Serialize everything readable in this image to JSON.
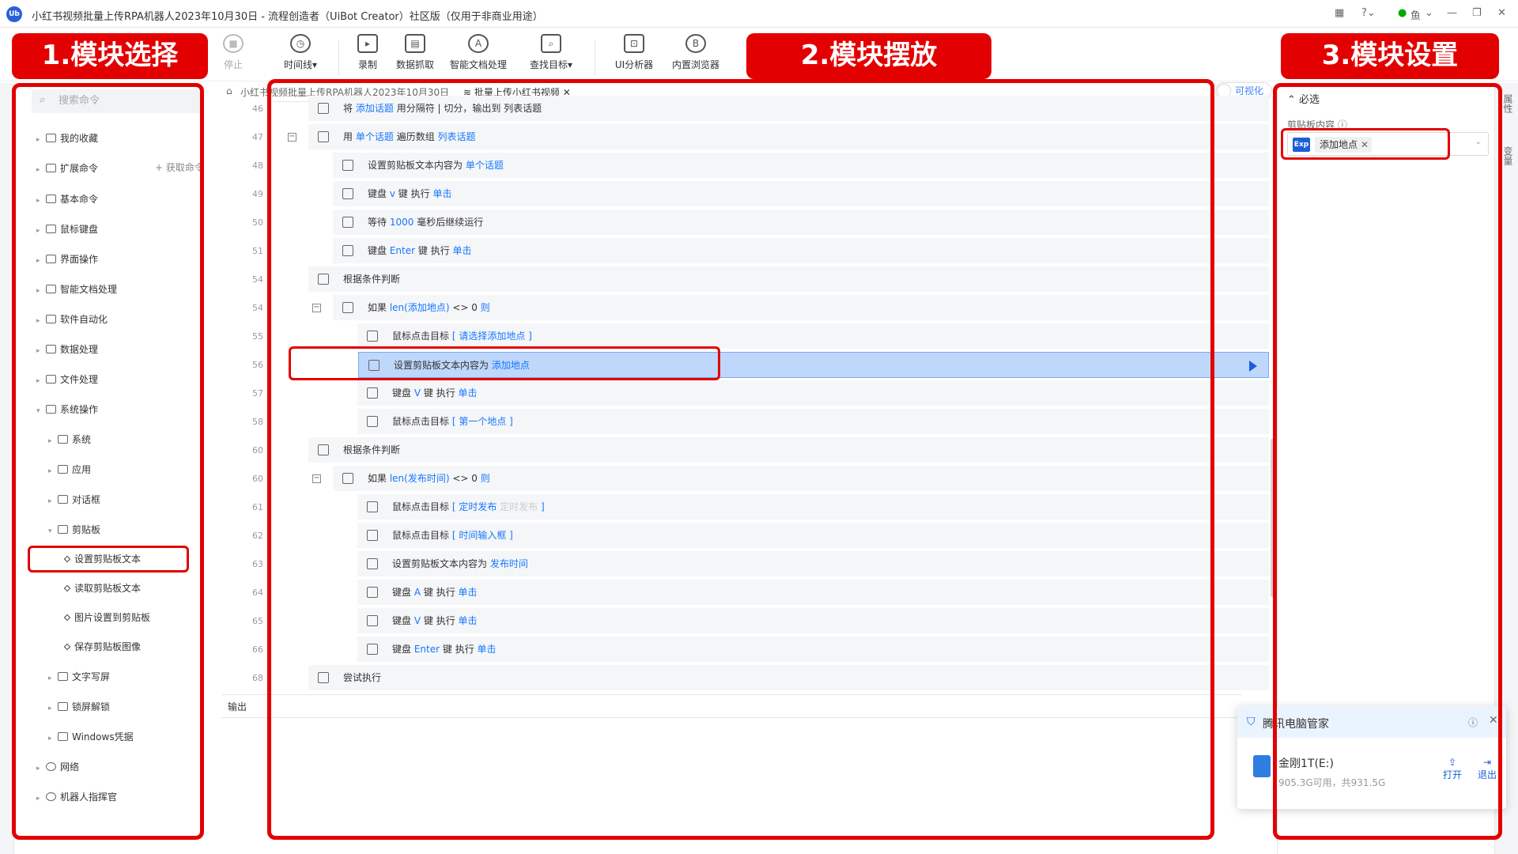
{
  "window": {
    "title": "小红书视频批量上传RPA机器人2023年10月30日 - 流程创造者（UiBot Creator）社区版（仅用于非商业用途）",
    "logo": "Ub",
    "user": "鱼"
  },
  "toolbar": {
    "stop": "停止",
    "timeline": "时间线▾",
    "record": "录制",
    "data_scrape": "数据抓取",
    "smart_doc": "智能文档处理",
    "find_target": "查找目标▾",
    "ui_analyzer": "UI分析器",
    "browser": "内置浏览器"
  },
  "annotations": {
    "section1": "1.模块选择",
    "section2": "2.模块摆放",
    "section3": "3.模块设置"
  },
  "left": {
    "search_placeholder": "搜索命令",
    "get_commands": "+ 获取命令",
    "items": [
      "我的收藏",
      "扩展命令",
      "基本命令",
      "鼠标键盘",
      "界面操作",
      "智能文档处理",
      "软件自动化",
      "数据处理",
      "文件处理",
      "系统操作"
    ],
    "sys_items": [
      "系统",
      "应用",
      "对话框",
      "剪贴板"
    ],
    "clipboard_items": [
      "设置剪贴板文本",
      "读取剪贴板文本",
      "图片设置到剪贴板",
      "保存剪贴板图像"
    ],
    "more_items": [
      "文字写屏",
      "锁屏解锁",
      "Windows凭据"
    ],
    "bottom_items": [
      "网络",
      "机器人指挥官"
    ]
  },
  "tabs": {
    "tab1": "小红书视频批量上传RPA机器人2023年10月30日",
    "tab2": "批量上传小红书视频",
    "visual_toggle": "可视化"
  },
  "code_rows": [
    {
      "ln": "46",
      "a": "将",
      "b": "添加话题",
      "c": "用分隔符 | 切分，输出到 列表话题",
      "d": ""
    },
    {
      "ln": "47",
      "a": "用",
      "b": "单个话题",
      "c": "遍历数组",
      "d": "列表话题"
    },
    {
      "ln": "48",
      "a": "设置剪贴板文本内容为",
      "b": "单个话题",
      "c": "",
      "d": ""
    },
    {
      "ln": "49",
      "a": "键盘",
      "b": "v",
      "c": "键 执行",
      "d": "单击"
    },
    {
      "ln": "50",
      "a": "等待",
      "b": "1000",
      "c": "毫秒后继续运行",
      "d": ""
    },
    {
      "ln": "51",
      "a": "键盘",
      "b": "Enter",
      "c": "键 执行",
      "d": "单击"
    },
    {
      "ln": "54",
      "a": "根据条件判断",
      "b": "",
      "c": "",
      "d": ""
    },
    {
      "ln": "54",
      "a": "如果",
      "b": "len(添加地点)",
      "c": "<> 0",
      "d": "则"
    },
    {
      "ln": "55",
      "a": "鼠标点击目标",
      "b": "[ 请选择添加地点",
      "c": "",
      "d": "]"
    },
    {
      "ln": "56",
      "a": "设置剪贴板文本内容为",
      "b": "添加地点",
      "c": "",
      "d": ""
    },
    {
      "ln": "57",
      "a": "键盘",
      "b": "V",
      "c": "键 执行",
      "d": "单击"
    },
    {
      "ln": "58",
      "a": "鼠标点击目标",
      "b": "[ 第一个地点",
      "c": "",
      "d": "]"
    },
    {
      "ln": "60",
      "a": "根据条件判断",
      "b": "",
      "c": "",
      "d": ""
    },
    {
      "ln": "60",
      "a": "如果",
      "b": "len(发布时间)",
      "c": "<> 0",
      "d": "则"
    },
    {
      "ln": "61",
      "a": "鼠标点击目标",
      "b": "[ 定时发布",
      "c": "定时发布",
      "d": "]"
    },
    {
      "ln": "62",
      "a": "鼠标点击目标",
      "b": "[ 时间输入框",
      "c": "",
      "d": "]"
    },
    {
      "ln": "63",
      "a": "设置剪贴板文本内容为",
      "b": "发布时间",
      "c": "",
      "d": ""
    },
    {
      "ln": "64",
      "a": "键盘",
      "b": "A",
      "c": "键 执行",
      "d": "单击"
    },
    {
      "ln": "65",
      "a": "键盘",
      "b": "V",
      "c": "键 执行",
      "d": "单击"
    },
    {
      "ln": "66",
      "a": "键盘",
      "b": "Enter",
      "c": "键 执行",
      "d": "单击"
    },
    {
      "ln": "68",
      "a": "尝试执行",
      "b": "",
      "c": "",
      "d": ""
    }
  ],
  "output_tab": "输出",
  "right": {
    "required": "⌃ 必选",
    "field_label": "剪贴板内容",
    "exp": "Exp",
    "chip": "添加地点",
    "rail_top": "属性",
    "rail_mid": "变量"
  },
  "popup": {
    "title": "腾讯电脑管家",
    "drive": "金刚1T(E:)",
    "size": "905.3G可用，共931.5G",
    "open": "打开",
    "exit": "退出"
  }
}
